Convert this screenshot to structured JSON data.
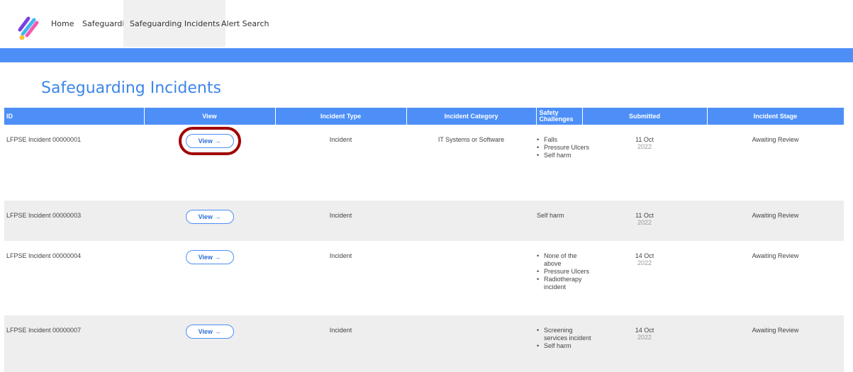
{
  "nav": {
    "items": [
      "Home",
      "Safeguarding",
      "Safeguarding Incidents",
      "Alert Search"
    ],
    "active_index": 2
  },
  "page": {
    "title": "Safeguarding Incidents"
  },
  "table": {
    "headers": {
      "id": "ID",
      "view": "View",
      "incident_type": "Incident Type",
      "incident_category": "Incident Category",
      "safety_challenges": "Safety Challenges",
      "submitted": "Submitted",
      "incident_stage": "Incident Stage"
    },
    "button_label": "View →",
    "rows": [
      {
        "id": "LFPSE Incident 00000001",
        "incident_type": "Incident",
        "incident_category": "IT Systems or Software",
        "safety_challenges": [
          "Falls",
          "Pressure Ulcers",
          "Self harm"
        ],
        "submitted_day": "11 Oct",
        "submitted_year": "2022",
        "incident_stage": "Awaiting Review"
      },
      {
        "id": "LFPSE Incident 00000003",
        "incident_type": "Incident",
        "incident_category": "",
        "safety_challenges_text": "Self harm",
        "submitted_day": "11 Oct",
        "submitted_year": "2022",
        "incident_stage": "Awaiting Review"
      },
      {
        "id": "LFPSE Incident 00000004",
        "incident_type": "Incident",
        "incident_category": "",
        "safety_challenges": [
          "None of the above",
          "Pressure Ulcers",
          "Radiotherapy incident"
        ],
        "submitted_day": "14 Oct",
        "submitted_year": "2022",
        "incident_stage": "Awaiting Review"
      },
      {
        "id": "LFPSE Incident 00000007",
        "incident_type": "Incident",
        "incident_category": "",
        "safety_challenges": [
          "Screening services incident",
          "Self harm"
        ],
        "submitted_day": "14 Oct",
        "submitted_year": "2022",
        "incident_stage": "Awaiting Review"
      }
    ]
  },
  "colors": {
    "accent": "#4d8ff7",
    "title": "#3d86e8",
    "highlight": "#a00000"
  }
}
